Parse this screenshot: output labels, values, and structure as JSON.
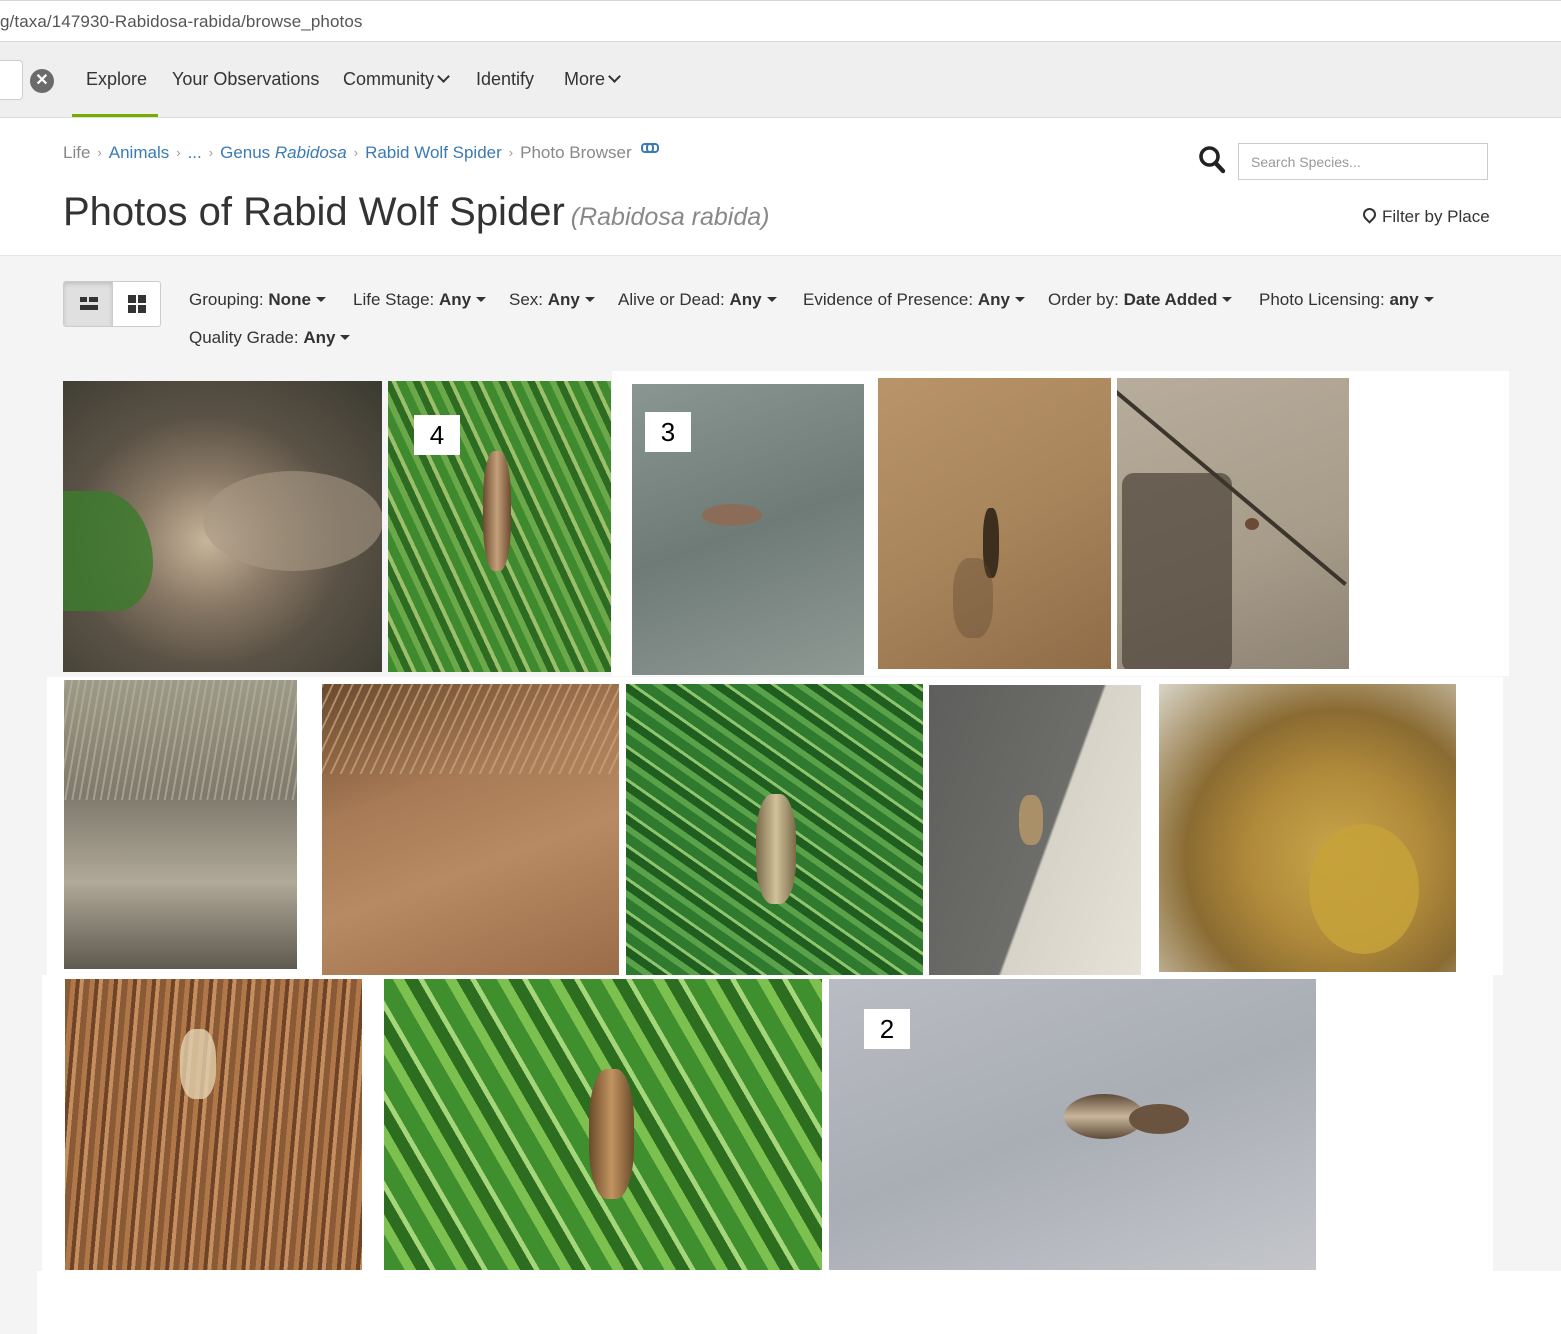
{
  "browser": {
    "url": "g/taxa/147930-Rabidosa-rabida/browse_photos"
  },
  "nav": {
    "clear_glyph": "✕",
    "items": [
      {
        "label": "Explore"
      },
      {
        "label": "Your Observations"
      },
      {
        "label": "Community"
      },
      {
        "label": "Identify"
      },
      {
        "label": "More"
      }
    ]
  },
  "breadcrumb": {
    "life": "Life",
    "animals": "Animals",
    "ellipsis": "...",
    "genus_prefix": "Genus ",
    "genus_name": "Rabidosa",
    "species": "Rabid Wolf Spider",
    "current": "Photo Browser",
    "sep": "›"
  },
  "page": {
    "title": "Photos of Rabid Wolf Spider",
    "scientific": "(Rabidosa rabida)"
  },
  "search": {
    "placeholder": "Search Species..."
  },
  "filter_place": {
    "label": "Filter by Place"
  },
  "filters": [
    {
      "label": "Grouping:",
      "value": "None"
    },
    {
      "label": "Life Stage:",
      "value": "Any"
    },
    {
      "label": "Sex:",
      "value": "Any"
    },
    {
      "label": "Alive or Dead:",
      "value": "Any"
    },
    {
      "label": "Evidence of Presence:",
      "value": "Any"
    },
    {
      "label": "Order by:",
      "value": "Date Added"
    },
    {
      "label": "Photo Licensing:",
      "value": "any"
    },
    {
      "label": "Quality Grade:",
      "value": "Any"
    }
  ],
  "photos": {
    "p2": {
      "badge": "4"
    },
    "p3": {
      "badge": "3"
    },
    "p13": {
      "badge": "2"
    }
  },
  "colors": {
    "accent": "#74ac00",
    "link": "#3a7ab5"
  }
}
